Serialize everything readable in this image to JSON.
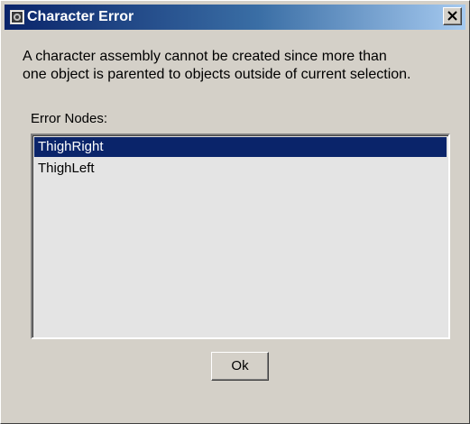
{
  "window": {
    "title": "Character Error",
    "app_icon": "app-icon",
    "close_icon": "close-icon"
  },
  "message": {
    "line1": "A character assembly cannot be created since more than",
    "line2": "one object is parented to objects outside of current selection."
  },
  "error_nodes": {
    "label": "Error Nodes:",
    "items": [
      {
        "label": "ThighRight",
        "selected": true
      },
      {
        "label": "ThighLeft",
        "selected": false
      }
    ]
  },
  "buttons": {
    "ok_label": "Ok"
  },
  "colors": {
    "titlebar_start": "#0a246a",
    "titlebar_end": "#a6caf0",
    "dialog_bg": "#d4d0c8",
    "list_bg": "#e4e4e4",
    "selection": "#0a246a"
  }
}
